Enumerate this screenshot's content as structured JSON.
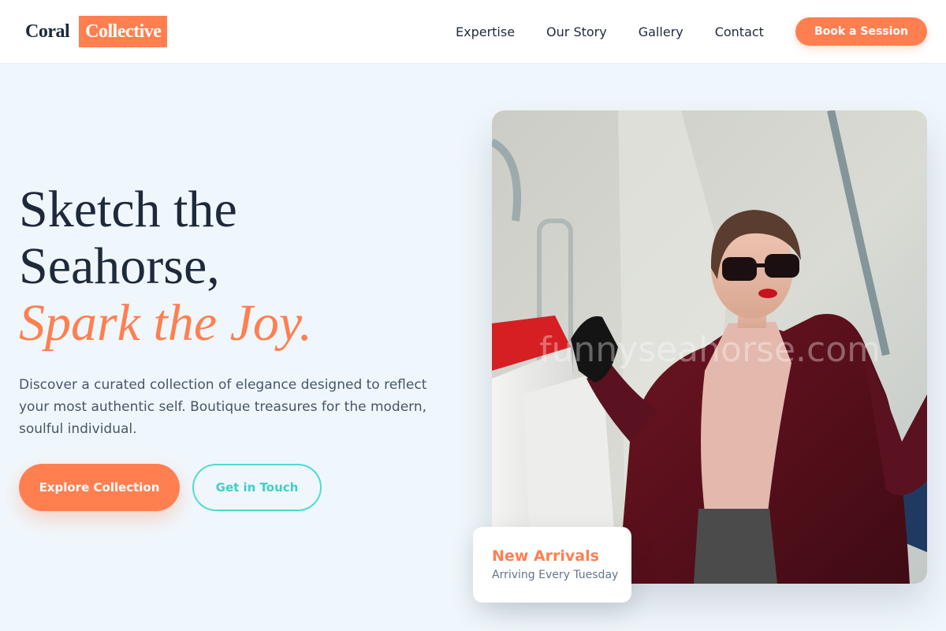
{
  "brand": {
    "word": "Coral",
    "accent": "Collective"
  },
  "nav": {
    "links": [
      "Expertise",
      "Our Story",
      "Gallery",
      "Contact"
    ],
    "cta": "Book a Session"
  },
  "hero": {
    "title_line_1": "Sketch the",
    "title_line_2": "Seahorse,",
    "title_line_3": "Spark the Joy.",
    "description": "Discover a curated collection of elegance designed to reflect your most authentic self. Boutique treasures for the modern, soulful individual.",
    "primary_cta": "Explore Collection",
    "secondary_cta": "Get in Touch",
    "image_watermark": "funnyseahorse.com"
  },
  "card": {
    "title": "New Arrivals",
    "subtitle": "Arriving Every Tuesday"
  },
  "colors": {
    "accent": "#ff7f50",
    "secondary": "#4ddbd2",
    "text": "#1e293b",
    "background": "#f0f7fc"
  },
  "icons": {
    "hero_photo": "woman-with-shopping-bags-photo"
  }
}
